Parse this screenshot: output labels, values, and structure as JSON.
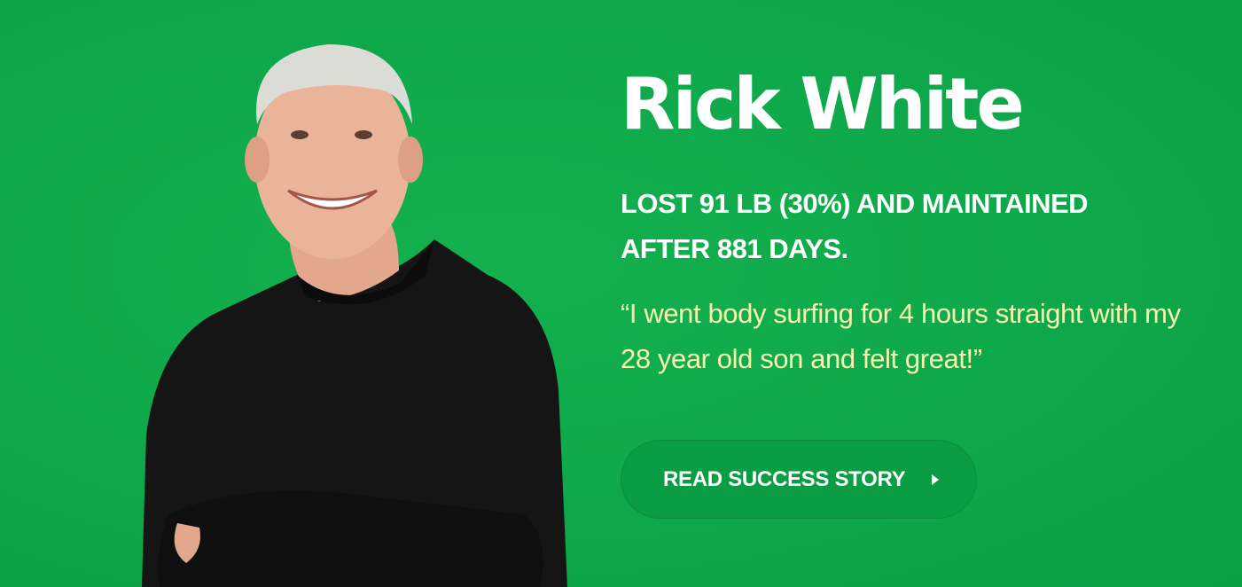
{
  "hero": {
    "name": "Rick White",
    "stat": "LOST 91 LB (30%) AND MAINTAINED AFTER 881 DAYS.",
    "quote": "“I went body surfing for 4 hours straight with my 28 year old son and felt great!”",
    "cta_label": "READ SUCCESS STORY",
    "cta_icon": "chevron-right-icon",
    "colors": {
      "background": "#0ea84a",
      "button": "#0b9d43",
      "quote_text": "#f6f3b0",
      "heading_text": "#ffffff"
    }
  }
}
